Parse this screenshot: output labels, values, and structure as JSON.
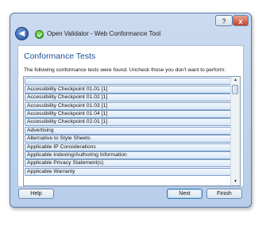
{
  "window": {
    "title": "Open Validator - Web Conformance Tool",
    "help_glyph": "?",
    "close_glyph": "x",
    "back_glyph": "◀"
  },
  "page": {
    "heading": "Conformance Tests",
    "instruction": "The following conformance tests were found. Uncheck those you don't want to perform:"
  },
  "tests": [
    "",
    "Accessibility Checkpoint 01.01 [1]",
    "Accessibility Checkpoint 01.02 [1]",
    "Accessibility Checkpoint 01.03 [1]",
    "Accessibility Checkpoint 01.04 [1]",
    "Accessibility Checkpoint 02.01 [1]",
    "Advertising",
    "Alternative to Style Sheets",
    "Applicable IP Considerations",
    "Applicable Indexing/Authoring Information",
    "Applicable Privacy Statement(s)",
    "Applicable Warranty"
  ],
  "buttons": {
    "help": "Help",
    "next": "Next",
    "finish": "Finish"
  },
  "scrollbar": {
    "up_glyph": "▲",
    "down_glyph": "▼"
  }
}
